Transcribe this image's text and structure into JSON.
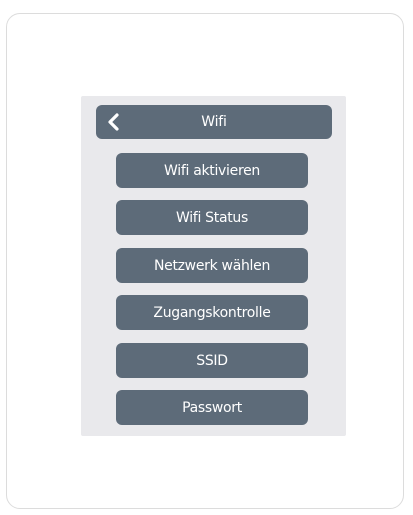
{
  "screen": {
    "header": {
      "title": "Wifi",
      "back_icon": "chevron-left-icon"
    },
    "menu_items": [
      {
        "label": "Wifi aktivieren"
      },
      {
        "label": "Wifi Status"
      },
      {
        "label": "Netzwerk wählen"
      },
      {
        "label": "Zugangskontrolle"
      },
      {
        "label": "SSID"
      },
      {
        "label": "Passwort"
      }
    ]
  },
  "colors": {
    "button_bg": "#5d6b79",
    "panel_bg": "#e9e9ec",
    "text": "#ffffff"
  }
}
